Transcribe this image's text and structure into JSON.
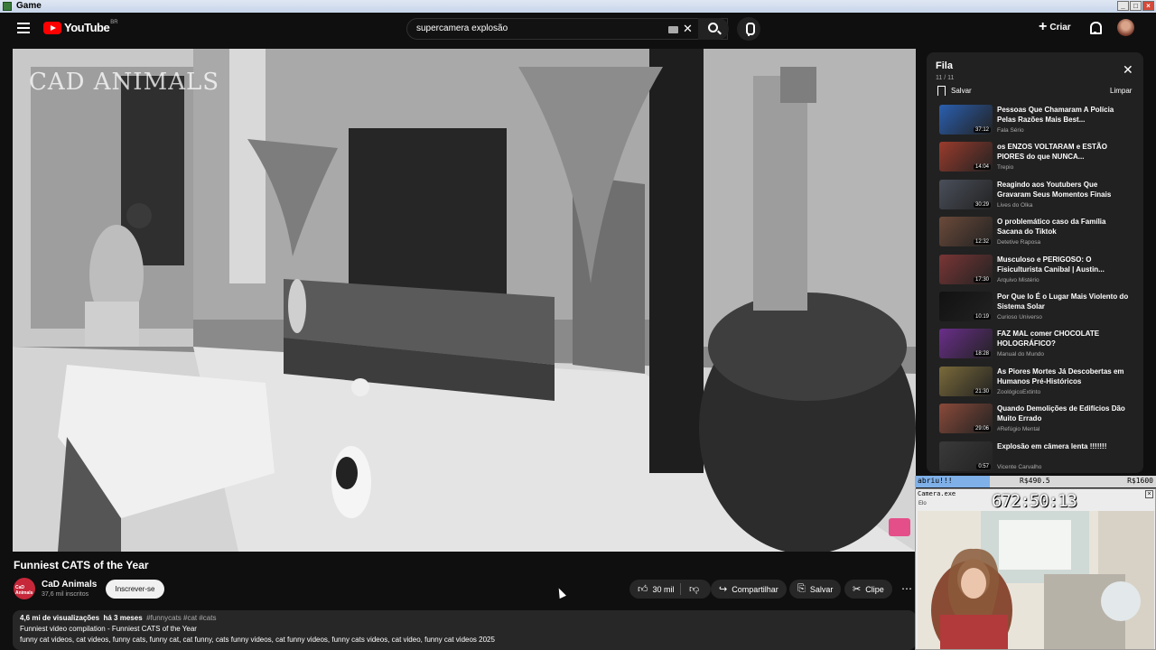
{
  "window": {
    "title": "Game"
  },
  "youtube": {
    "logo_text": "YouTube",
    "country_code": "BR"
  },
  "search": {
    "query": "supercamera explosão",
    "clear": "✕"
  },
  "header": {
    "create_label": "Criar"
  },
  "video": {
    "watermark": "CAD ANIMALS",
    "title": "Funniest CATS of the Year",
    "channel": {
      "name": "CaD Animals",
      "avatar_text": "CaD Animals",
      "subscribers": "37,6 mil inscritos"
    },
    "subscribe_label": "Inscrever-se",
    "actions": {
      "likes": "30 mil",
      "share": "Compartilhar",
      "save": "Salvar",
      "clip": "Clipe",
      "more": "⋯"
    },
    "description": {
      "views": "4,6 mi de visualizações",
      "age": "há 3 meses",
      "hashtags": "#funnycats #cat #cats",
      "line2": "Funniest video compilation - Funniest CATS of the Year",
      "line3": "funny cat videos, cat videos, funny cats, funny cat, cat funny, cats funny videos, cat funny videos, funny cats videos, cat video, funny cat videos 2025"
    }
  },
  "queue": {
    "title": "Fila",
    "count": "11 / 11",
    "save_label": "Salvar",
    "clear_label": "Limpar",
    "items": [
      {
        "title": "Pessoas Que Chamaram A Polícia Pelas Razões Mais Best...",
        "channel": "Fala Sério",
        "duration": "37:12",
        "color": "#2a5fb0"
      },
      {
        "title": "os ENZOS VOLTARAM e ESTÃO PIORES do que NUNCA...",
        "channel": "Trepio",
        "duration": "14:04",
        "color": "#9a3b2c"
      },
      {
        "title": "Reagindo aos Youtubers Que Gravaram Seus Momentos Finais",
        "channel": "Lives do Olka",
        "duration": "30:29",
        "color": "#4a4f5a"
      },
      {
        "title": "O problemático caso da Família Sacana do Tiktok",
        "channel": "Detetive Raposa",
        "duration": "12:32",
        "color": "#6b4a3a"
      },
      {
        "title": "Musculoso e PERIGOSO: O Fisiculturista Canibal | Austin...",
        "channel": "Arquivo Mistério",
        "duration": "17:30",
        "color": "#7a3535"
      },
      {
        "title": "Por Que Io É o Lugar Mais Violento do Sistema Solar",
        "channel": "Curioso Universo",
        "duration": "10:19",
        "color": "#111111"
      },
      {
        "title": "FAZ MAL comer CHOCOLATE HOLOGRÁFICO?",
        "channel": "Manual do Mundo",
        "duration": "18:28",
        "color": "#6a2e8a"
      },
      {
        "title": "As Piores Mortes Já Descobertas em Humanos Pré-Históricos",
        "channel": "ZoológicoExtinto",
        "duration": "21:30",
        "color": "#7a6a3a"
      },
      {
        "title": "Quando Demolições de Edifícios Dão Muito Errado",
        "channel": "#Refúgio Mental",
        "duration": "29:06",
        "color": "#8a4a3a"
      },
      {
        "title": "Explosão em câmera lenta !!!!!!!",
        "channel": "Vicente Carvalho",
        "duration": "0:57",
        "color": "#3a3a3a"
      }
    ]
  },
  "overlay": {
    "goal_label": "abriu!!!",
    "goal_current": "R$490.5",
    "goal_target": "R$1600",
    "progress": 0.31,
    "camera_title": "Camera.exe",
    "camera_sub": "Elo",
    "timer": "672:50:13"
  }
}
